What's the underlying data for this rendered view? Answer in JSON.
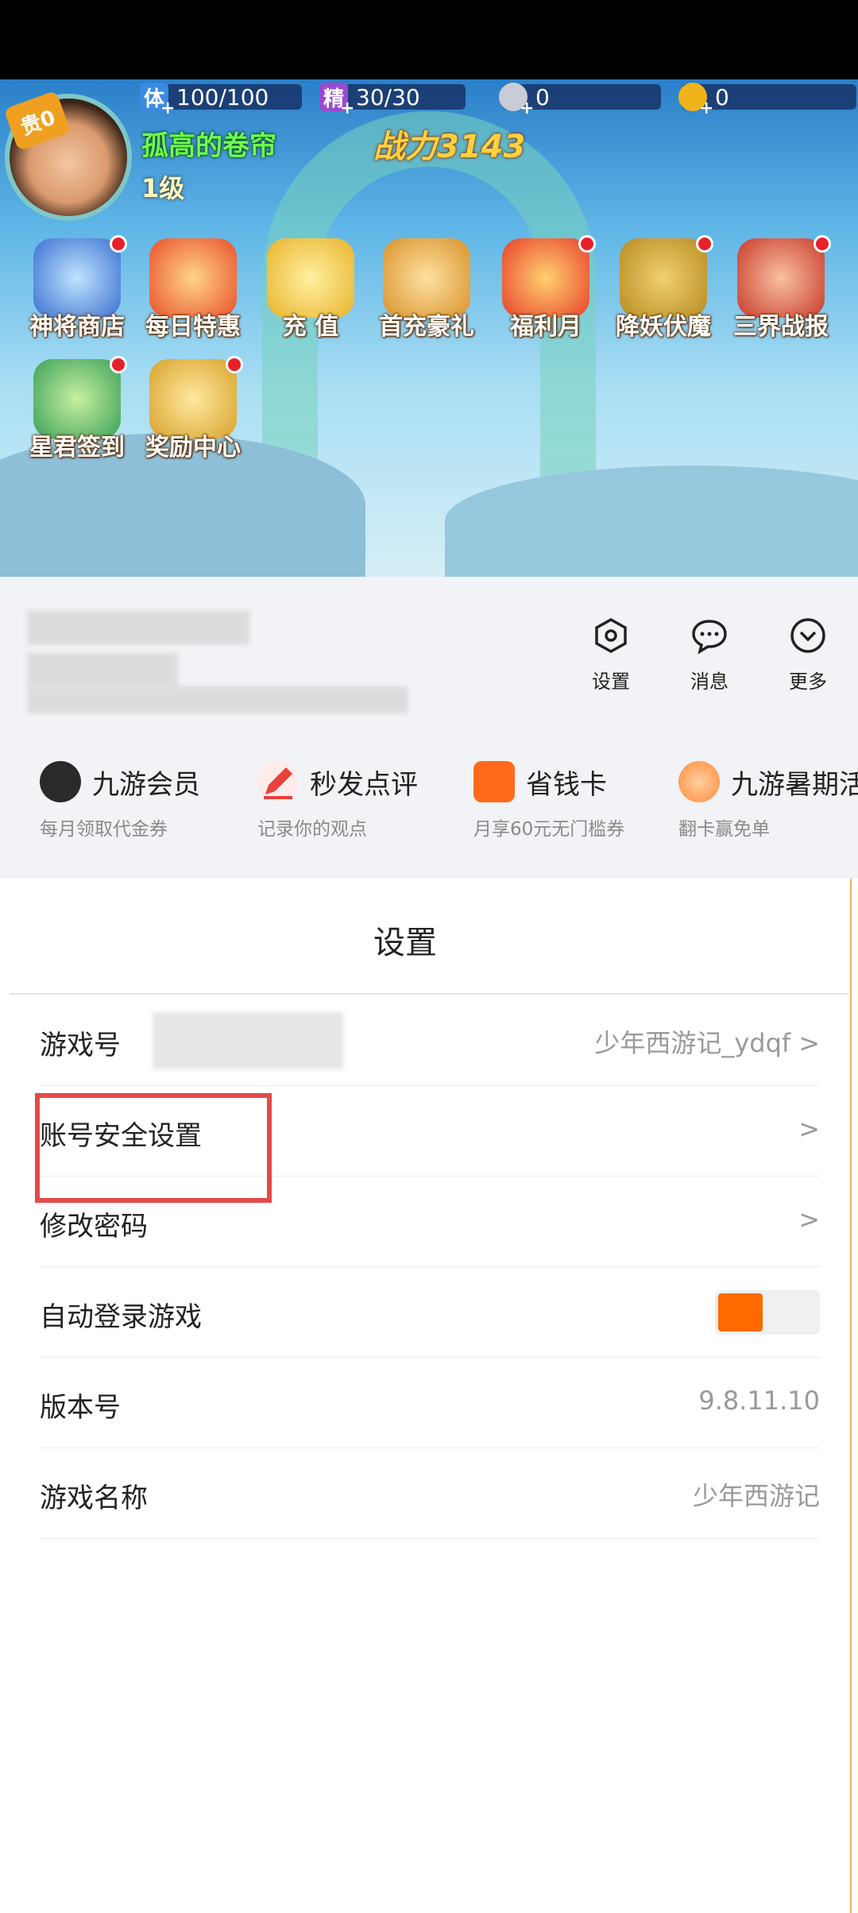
{
  "game": {
    "stats": [
      {
        "icon": "体",
        "value": "100/100"
      },
      {
        "icon": "精",
        "value": "30/30"
      },
      {
        "icon": "silver-coin-icon",
        "value": "0"
      },
      {
        "icon": "gold-ingot-icon",
        "value": "0"
      }
    ],
    "vip": "贵0",
    "player_name": "孤高的卷帘",
    "level": "1级",
    "power": "战力3143",
    "icons": [
      {
        "label": "神将商店",
        "color": "#3a6fd0",
        "dot": true
      },
      {
        "label": "每日特惠",
        "color": "#e8502a",
        "dot": false
      },
      {
        "label": "充 值",
        "color": "#e8b32a",
        "dot": false
      },
      {
        "label": "首充豪礼",
        "color": "#d8922a",
        "dot": false
      },
      {
        "label": "福利月",
        "color": "#e8402a",
        "dot": true
      },
      {
        "label": "降妖伏魔",
        "color": "#b88a20",
        "dot": true
      },
      {
        "label": "三界战报",
        "color": "#c83a2a",
        "dot": true
      },
      {
        "label": "星君签到",
        "color": "#3aa05a",
        "dot": true
      },
      {
        "label": "奖励中心",
        "color": "#d8a22a",
        "dot": true
      }
    ]
  },
  "profile": {
    "tools": [
      {
        "label": "设置",
        "icon": "hexagon-settings-icon"
      },
      {
        "label": "消息",
        "icon": "chat-bubble-icon"
      },
      {
        "label": "更多",
        "icon": "chevron-circle-icon"
      }
    ],
    "cards": [
      {
        "title": "九游会员",
        "subtitle": "每月领取代金券",
        "icon": "crown-icon",
        "color": "#2a2a2a"
      },
      {
        "title": "秒发点评",
        "subtitle": "记录你的观点",
        "icon": "pen-icon",
        "color": "#e8403a"
      },
      {
        "title": "省钱卡",
        "subtitle": "月享60元无门槛券",
        "icon": "card-icon",
        "color": "#ff6a1a"
      },
      {
        "title": "九游暑期活",
        "subtitle": "翻卡赢免单",
        "icon": "game-mascot-icon",
        "color": "#ff8a3a"
      }
    ]
  },
  "settings": {
    "title": "设置",
    "rows": [
      {
        "label": "游戏号",
        "value": "少年西游记_ydqf"
      },
      {
        "label": "账号安全设置",
        "value": ""
      },
      {
        "label": "修改密码",
        "value": ""
      },
      {
        "label": "自动登录游戏",
        "value": ""
      },
      {
        "label": "版本号",
        "value": "9.8.11.10"
      },
      {
        "label": "游戏名称",
        "value": "少年西游记"
      }
    ],
    "auto_login": true
  }
}
